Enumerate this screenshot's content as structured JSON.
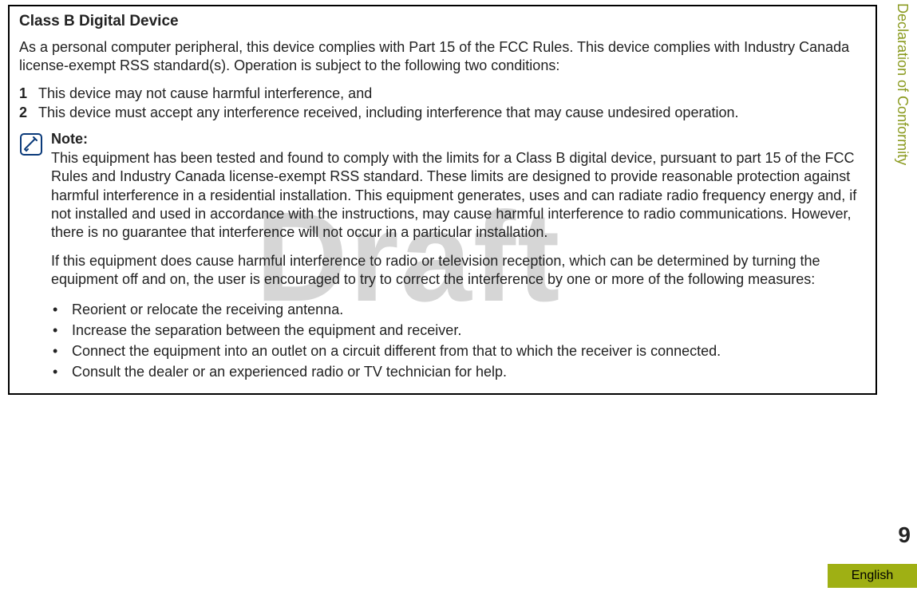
{
  "watermark": "Draft",
  "box": {
    "title": "Class B Digital Device",
    "intro": "As a personal computer peripheral, this device complies with Part 15 of the FCC Rules. This device complies with Industry Canada license-exempt RSS standard(s). Operation is subject to the following two conditions:",
    "numbered": [
      {
        "num": "1",
        "text": "This device may not cause harmful interference, and"
      },
      {
        "num": "2",
        "text": "This device must accept any interference received, including interference that may cause undesired operation."
      }
    ],
    "note": {
      "label": "Note:",
      "para1": "This equipment has been tested and found to comply with the limits for a Class B digital device, pursuant to part 15 of the FCC Rules and Industry Canada license-exempt RSS standard. These limits are designed to provide reasonable protection against harmful interference in a residential installation. This equipment generates, uses and can radiate radio frequency energy and, if not installed and used in accordance with the instructions, may cause harmful interference to radio communications. However, there is no guarantee that interference will not occur in a particular installation.",
      "para2": "If this equipment does cause harmful interference to radio or television reception, which can be determined by turning the equipment off and on, the user is encouraged to try to correct the interference by one or more of the following measures:",
      "bullets": [
        "Reorient or relocate the receiving antenna.",
        "Increase the separation between the equipment and receiver.",
        "Connect the equipment into an outlet on a circuit different from that to which the receiver is connected.",
        "Consult the dealer or an experienced radio or TV technician for help."
      ]
    }
  },
  "sidebar": {
    "section": "Declaration of Conformity",
    "page": "9",
    "language": "English"
  }
}
